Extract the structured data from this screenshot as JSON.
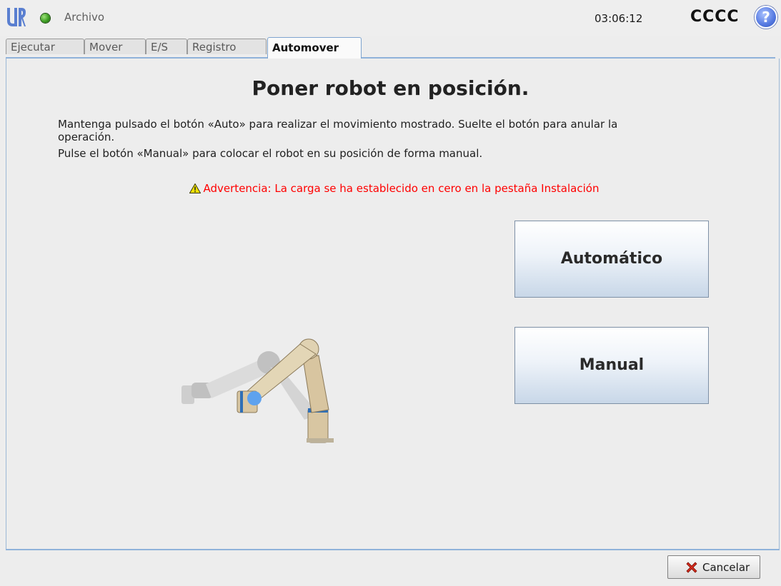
{
  "topbar": {
    "file_menu_label": "Archivo",
    "clock": "03:06:12",
    "robot_name": "CCCC",
    "help_symbol": "?"
  },
  "tabs": [
    {
      "label": "Ejecutar",
      "active": false
    },
    {
      "label": "Mover",
      "active": false
    },
    {
      "label": "E/S",
      "active": false
    },
    {
      "label": "Registro",
      "active": false
    },
    {
      "label": "Automover",
      "active": true
    }
  ],
  "main": {
    "title": "Poner robot en posición.",
    "instructions": [
      "Mantenga pulsado el botón «Auto» para realizar el movimiento mostrado. Suelte el botón para anular la",
      "operación.",
      "Pulse el botón «Manual» para colocar el robot en su posición de forma manual."
    ],
    "warning": "Advertencia: La carga se ha establecido en cero en la pestaña Instalación",
    "auto_button_label": "Automático",
    "manual_button_label": "Manual"
  },
  "footer": {
    "cancel_label": "Cancelar"
  },
  "icons": {
    "logo": "ur-logo-icon",
    "status": "status-green-dot-icon",
    "help": "help-icon",
    "warning": "warning-triangle-icon",
    "cancel": "red-x-icon"
  },
  "colors": {
    "warning_text": "#ff0000",
    "status_ok": "#3c9d22",
    "tab_accent": "#8fb2da",
    "help_blue": "#5478e0"
  }
}
